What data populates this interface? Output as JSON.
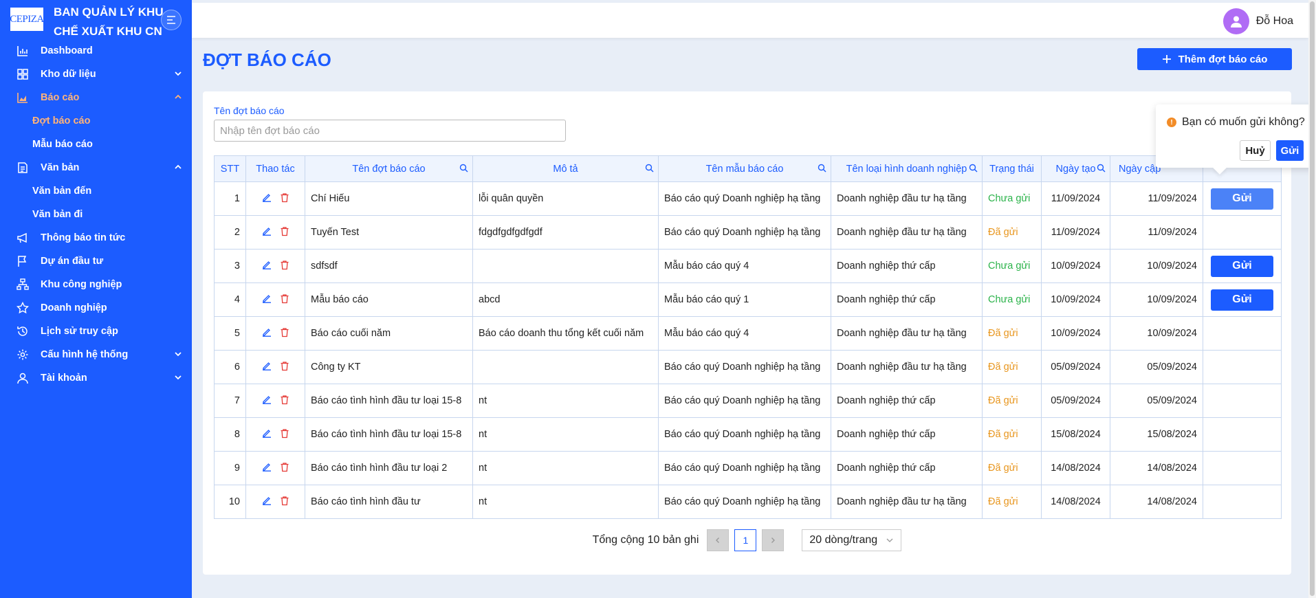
{
  "brand": {
    "logo_text": "CEPIZA",
    "title_line1": "BAN QUẢN LÝ KHU",
    "title_line2": "CHẾ XUẤT KHU CN"
  },
  "sidebar": {
    "items": [
      {
        "label": "Dashboard",
        "icon": "chart-bar-icon"
      },
      {
        "label": "Kho dữ liệu",
        "icon": "grid-icon"
      },
      {
        "label": "Báo cáo",
        "icon": "area-chart-icon"
      },
      {
        "label": "Văn bản",
        "icon": "document-icon"
      },
      {
        "label": "Thông báo tin tức",
        "icon": "megaphone-icon"
      },
      {
        "label": "Dự án đầu tư",
        "icon": "flag-icon"
      },
      {
        "label": "Khu công nghiệp",
        "icon": "org-chart-icon"
      },
      {
        "label": "Doanh nghiệp",
        "icon": "star-icon"
      },
      {
        "label": "Lịch sử truy cập",
        "icon": "history-icon"
      },
      {
        "label": "Cấu hình hệ thống",
        "icon": "gear-icon"
      },
      {
        "label": "Tài khoản",
        "icon": "user-icon"
      }
    ],
    "bao_cao_sub": [
      "Đợt báo cáo",
      "Mẫu báo cáo"
    ],
    "van_ban_sub": [
      "Văn bản đến",
      "Văn bản đi"
    ]
  },
  "header": {
    "user_name": "Đỗ Hoa"
  },
  "page": {
    "title": "ĐỢT BÁO CÁO",
    "add_button": "Thêm đợt báo cáo"
  },
  "filter": {
    "label": "Tên đợt báo cáo",
    "placeholder": "Nhập tên đợt báo cáo"
  },
  "table": {
    "columns": [
      "STT",
      "Thao tác",
      "Tên đợt báo cáo",
      "Mô tả",
      "Tên mẫu báo cáo",
      "Tên loại hình doanh nghiệp",
      "Trạng thái",
      "Ngày tạo",
      "Ngày cập"
    ],
    "rows": [
      {
        "stt": "1",
        "name": "Chí Hiếu",
        "desc": "lỗi quân quyền",
        "template": "Báo cáo quý Doanh nghiệp hạ tầng",
        "type": "Doanh nghiệp đầu tư hạ tầng",
        "status": "Chưa gửi",
        "created": "11/09/2024",
        "updated": "11/09/2024",
        "send": "Gửi"
      },
      {
        "stt": "2",
        "name": "Tuyến Test",
        "desc": "fdgdfgdfgdfgdf",
        "template": "Báo cáo quý Doanh nghiệp hạ tầng",
        "type": "Doanh nghiệp đầu tư hạ tầng",
        "status": "Đã gửi",
        "created": "11/09/2024",
        "updated": "11/09/2024",
        "send": ""
      },
      {
        "stt": "3",
        "name": "sdfsdf",
        "desc": "",
        "template": "Mẫu báo cáo quý 4",
        "type": "Doanh nghiệp thứ cấp",
        "status": "Chưa gửi",
        "created": "10/09/2024",
        "updated": "10/09/2024",
        "send": "Gửi"
      },
      {
        "stt": "4",
        "name": "Mẫu báo cáo",
        "desc": "abcd",
        "template": "Mẫu báo cáo quý 1",
        "type": "Doanh nghiệp thứ cấp",
        "status": "Chưa gửi",
        "created": "10/09/2024",
        "updated": "10/09/2024",
        "send": "Gửi"
      },
      {
        "stt": "5",
        "name": "Báo cáo cuối năm",
        "desc": "Báo cáo doanh thu tổng kết cuối năm",
        "template": "Mẫu báo cáo quý 4",
        "type": "Doanh nghiệp đầu tư hạ tầng",
        "status": "Đã gửi",
        "created": "10/09/2024",
        "updated": "10/09/2024",
        "send": ""
      },
      {
        "stt": "6",
        "name": "Công ty KT",
        "desc": "",
        "template": "Báo cáo quý Doanh nghiệp hạ tầng",
        "type": "Doanh nghiệp đầu tư hạ tầng",
        "status": "Đã gửi",
        "created": "05/09/2024",
        "updated": "05/09/2024",
        "send": ""
      },
      {
        "stt": "7",
        "name": "Báo cáo tình hình đầu tư loại 15-8",
        "desc": "nt",
        "template": "Báo cáo quý Doanh nghiệp hạ tầng",
        "type": "Doanh nghiệp thứ cấp",
        "status": "Đã gửi",
        "created": "05/09/2024",
        "updated": "05/09/2024",
        "send": ""
      },
      {
        "stt": "8",
        "name": "Báo cáo tình hình đầu tư loại 15-8",
        "desc": "nt",
        "template": "Báo cáo quý Doanh nghiệp hạ tầng",
        "type": "Doanh nghiệp thứ cấp",
        "status": "Đã gửi",
        "created": "15/08/2024",
        "updated": "15/08/2024",
        "send": ""
      },
      {
        "stt": "9",
        "name": "Báo cáo tình hình đầu tư loại 2",
        "desc": "nt",
        "template": "Báo cáo quý Doanh nghiệp hạ tầng",
        "type": "Doanh nghiệp thứ cấp",
        "status": "Đã gửi",
        "created": "14/08/2024",
        "updated": "14/08/2024",
        "send": ""
      },
      {
        "stt": "10",
        "name": "Báo cáo tình hình đầu tư",
        "desc": "nt",
        "template": "Báo cáo quý Doanh nghiệp hạ tầng",
        "type": "Doanh nghiệp đầu tư hạ tầng",
        "status": "Đã gửi",
        "created": "14/08/2024",
        "updated": "14/08/2024",
        "send": ""
      }
    ]
  },
  "pagination": {
    "total_text": "Tổng cộng 10 bản ghi",
    "current_page": "1",
    "page_size": "20 dòng/trang"
  },
  "popconfirm": {
    "message": "Bạn có muốn gửi không?",
    "cancel": "Huỷ",
    "ok": "Gửi"
  },
  "colors": {
    "primary": "#1c5cff",
    "status_pending": "#2bb34a",
    "status_sent": "#e8961e",
    "delete": "#e53935",
    "active_menu": "#ffb37a"
  }
}
